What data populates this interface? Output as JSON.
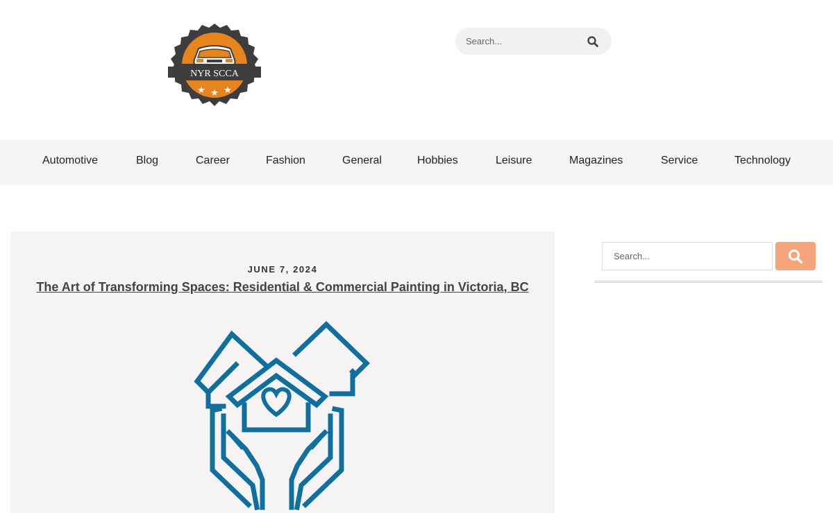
{
  "logo": {
    "text": "NYR SCCA",
    "colors": {
      "badge": "#3d3d3d",
      "orange": "#e8841e"
    }
  },
  "header_search": {
    "placeholder": "Search...",
    "icon": "search-icon"
  },
  "nav": {
    "items": [
      {
        "label": "Automotive"
      },
      {
        "label": "Blog"
      },
      {
        "label": "Career"
      },
      {
        "label": "Fashion"
      },
      {
        "label": "General"
      },
      {
        "label": "Hobbies"
      },
      {
        "label": "Leisure"
      },
      {
        "label": "Magazines"
      },
      {
        "label": "Service"
      },
      {
        "label": "Technology"
      }
    ]
  },
  "post": {
    "date": "JUNE 7, 2024",
    "title": "The Art of Transforming Spaces: Residential & Commercial Painting in Victoria, BC",
    "image": {
      "icon": "houses-in-hands-icon",
      "color": "#0f6f9e"
    }
  },
  "sidebar": {
    "search": {
      "placeholder": "Search...",
      "button_color": "#f6a47c",
      "icon": "search-icon"
    }
  }
}
